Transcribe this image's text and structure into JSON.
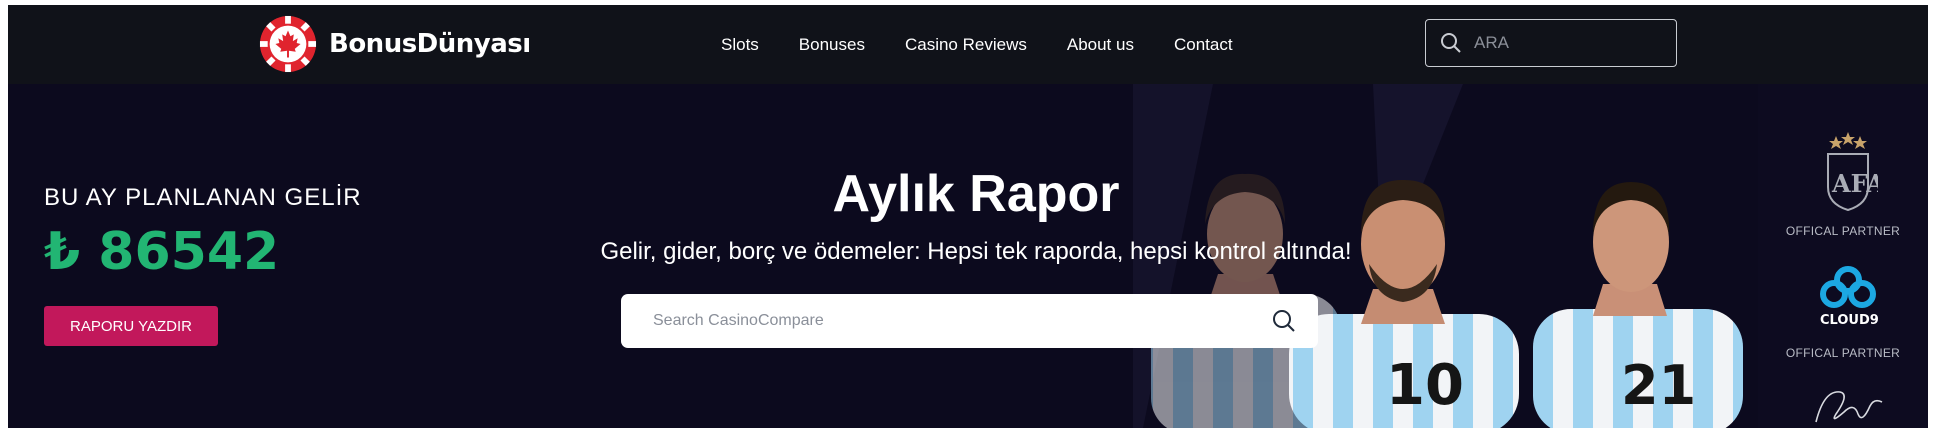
{
  "brand": {
    "name": "BonusDünyası",
    "chip_color": "#e0242e"
  },
  "nav": {
    "items": [
      {
        "label": "Slots"
      },
      {
        "label": "Bonuses"
      },
      {
        "label": "Casino Reviews"
      },
      {
        "label": "About us"
      },
      {
        "label": "Contact"
      }
    ],
    "search": {
      "placeholder": "ARA",
      "icon": "search-icon"
    }
  },
  "income": {
    "title": "BU AY PLANLANAN GELİR",
    "value": "₺ 86542",
    "color": "#22b573",
    "button_label": "RAPORU YAZDIR",
    "button_color": "#c2185b"
  },
  "hero": {
    "title": "Aylık Rapor",
    "subtitle": "Gelir, gider, borç ve ödemeler: Hepsi tek raporda, hepsi kontrol altında!",
    "search_placeholder": "Search CasinoCompare",
    "search_icon": "search-icon",
    "background_color": "#0c0a1e"
  },
  "players": [
    {
      "number": ""
    },
    {
      "number": "10"
    },
    {
      "number": "21"
    }
  ],
  "partners": [
    {
      "name": "AFA",
      "label": "OFFICAL PARTNER"
    },
    {
      "name": "CLOUD9",
      "label": "OFFICAL PARTNER"
    }
  ]
}
